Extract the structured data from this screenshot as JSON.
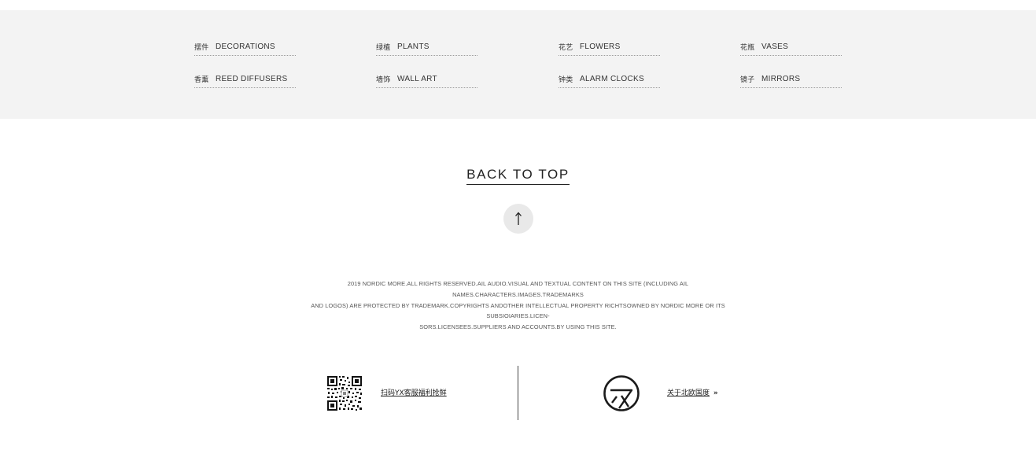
{
  "categories": [
    {
      "zh": "摆件",
      "en": "DECORATIONS"
    },
    {
      "zh": "绿植",
      "en": "PLANTS"
    },
    {
      "zh": "花艺",
      "en": "FLOWERS"
    },
    {
      "zh": "花瓶",
      "en": "VASES"
    },
    {
      "zh": "香薰",
      "en": "REED DIFFUSERS"
    },
    {
      "zh": "墙饰",
      "en": "WALL ART"
    },
    {
      "zh": "钟类",
      "en": "ALARM CLOCKS"
    },
    {
      "zh": "镜子",
      "en": "MIRRORS"
    }
  ],
  "back_to_top": {
    "label": "BACK TO TOP",
    "icon": "arrow-up-icon"
  },
  "legal": {
    "line1": "2019 NORDIC MORE.ALL RIGHTS RESERVED.AIL AUDIO.VISUAL AND TEXTUAL CONTENT ON THIS SITE (INCLUDING AIL NAMES.CHARACTERS.IMAGES.TRADEMARKS",
    "line2": "AND LOGOS) ARE PROTECTED BY TRADEMARK.COPYRIGHTS ANDOTHER INTELLECTUAL PROPERTY RICHTSOWNED BY NORDIC MORE OR ITS SUBSIOIARIES.LICEN-",
    "line3": "SORS.LICENSEES.SUPPLIERS AND ACCOUNTS.BY USING THIS SITE."
  },
  "footer": {
    "qr_icon": "qr-code-icon",
    "qr_label": "扫码YX客服福利抢鲜",
    "logo_icon": "brand-logo-icon",
    "about_label": "关于北欧国度",
    "about_arrow": "»"
  },
  "colors": {
    "band_background": "#f3f3f3",
    "text": "#333333",
    "circle_background": "#e9e9e9"
  }
}
